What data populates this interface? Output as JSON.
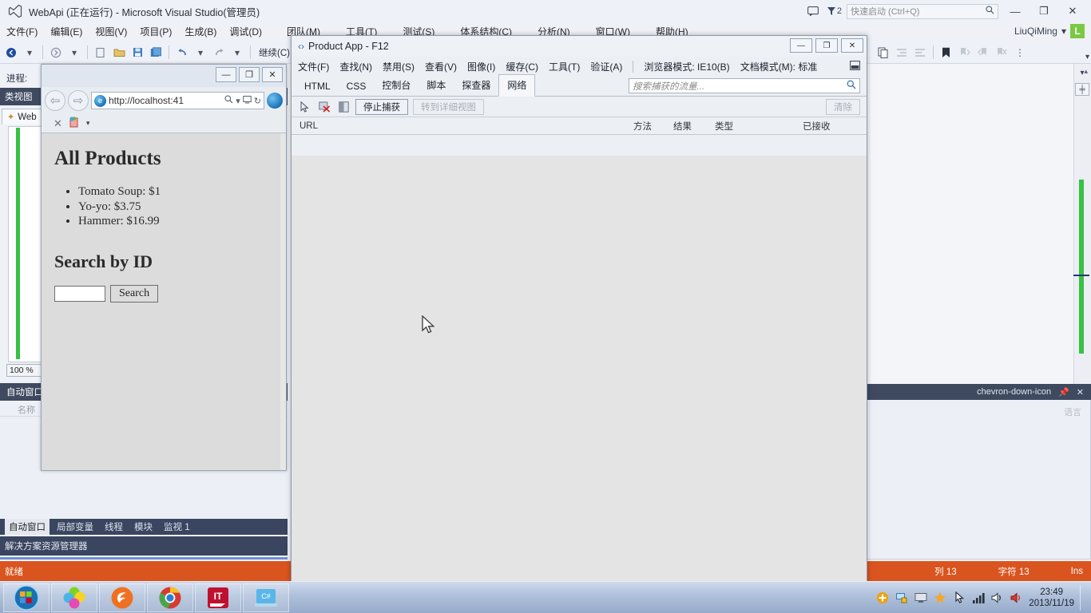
{
  "vs": {
    "title": "WebApi (正在运行) - Microsoft Visual Studio(管理员)",
    "logo_icon": "visual-studio-logo",
    "menu": [
      "文件(F)",
      "编辑(E)",
      "视图(V)",
      "项目(P)",
      "生成(B)",
      "调试(D)",
      "团队(M)",
      "工具(T)",
      "测试(S)",
      "体系结构(C)",
      "分析(N)",
      "窗口(W)",
      "帮助(H)"
    ],
    "titlebar_right": {
      "feedback_icon": "feedback-icon",
      "notification_icon": "notification-flag-icon",
      "notification_count": "2",
      "quick_launch_placeholder": "快速启动 (Ctrl+Q)",
      "quick_launch_value": "",
      "search_icon": "search-icon",
      "minimize": "—",
      "maximize": "❐",
      "close": "✕"
    },
    "user": {
      "name": "LiuQiMing",
      "chevron": "▾",
      "avatar_letter": "L",
      "avatar_color": "#7ac943"
    },
    "toolbar": {
      "continue_label": "继续(C)",
      "icons": [
        "back-icon",
        "forward-icon",
        "navigate-icon",
        "open-icon",
        "save-icon",
        "save-all-icon",
        "undo-icon",
        "redo-icon",
        "copy-icon",
        "indent-icon",
        "outdent-icon",
        "bookmark-icon",
        "comment-icon",
        "uncomment-icon",
        "overflow-icon"
      ]
    },
    "left_panel": {
      "process_label": "进程:",
      "classview_title": "类视图",
      "classview_chevron": "▾",
      "web_tab_label": "Web",
      "web_tab_icon": "web-file-icon",
      "zoom_level": "100 %",
      "auto_window_title": "自动窗口",
      "column_header": "名称"
    },
    "bottom_tabs": [
      {
        "label": "自动窗口",
        "active": true
      },
      {
        "label": "局部变量",
        "active": false
      },
      {
        "label": "线程",
        "active": false
      },
      {
        "label": "模块",
        "active": false
      },
      {
        "label": "监视 1",
        "active": false
      }
    ],
    "solution_explorer_label": "解决方案资源管理器",
    "right_dock": {
      "dropdown_icon": "chevron-down-icon",
      "pin_icon": "pin-icon",
      "close_icon": "close-icon",
      "faint_text": "语言"
    },
    "statusbar": {
      "status": "就绪",
      "column": "列 13",
      "character": "字符 13",
      "insert_mode": "Ins",
      "color": "#d9541e"
    }
  },
  "ie": {
    "window_buttons": {
      "minimize": "—",
      "maximize": "❐",
      "close": "✕"
    },
    "back_icon": "back-arrow-icon",
    "forward_icon": "forward-arrow-icon",
    "address": "http://localhost:41",
    "address_icons": {
      "search": "🔎",
      "dropdown": "▾",
      "compat": "⛶",
      "refresh": "↻"
    },
    "tab_close_icon": "✕",
    "tab_icon": "page-icon",
    "tab_dropdown": "▾",
    "page": {
      "heading1": "All Products",
      "products": [
        "Tomato Soup: $1",
        "Yo-yo: $3.75",
        "Hammer: $16.99"
      ],
      "heading2": "Search by ID",
      "search_value": "",
      "search_button": "Search"
    }
  },
  "f12": {
    "title": "Product App - F12",
    "title_icon": "f12-code-icon",
    "window_buttons": {
      "minimize": "—",
      "maximize": "❐",
      "close": "✕"
    },
    "menu": [
      "文件(F)",
      "查找(N)",
      "禁用(S)",
      "查看(V)",
      "图像(I)",
      "缓存(C)",
      "工具(T)",
      "验证(A)"
    ],
    "browser_mode": "浏览器模式: IE10(B)",
    "document_mode": "文档模式(M): 标准",
    "dock_icon": "dock-icon",
    "tabs": [
      {
        "label": "HTML",
        "active": false
      },
      {
        "label": "CSS",
        "active": false
      },
      {
        "label": "控制台",
        "active": false
      },
      {
        "label": "脚本",
        "active": false
      },
      {
        "label": "探查器",
        "active": false
      },
      {
        "label": "网络",
        "active": true
      }
    ],
    "search_placeholder": "搜索捕获的流量...",
    "search_value": "",
    "search_icon": "search-icon",
    "toolbar": {
      "select_icon": "cursor-select-icon",
      "clear_entries_icon": "clear-entries-icon",
      "image_icon": "image-icon",
      "stop_capture": "停止捕获",
      "detail_view": "转到详细视图",
      "clear": "清除"
    },
    "columns": [
      "URL",
      "方法",
      "结果",
      "类型",
      "已接收"
    ],
    "rows": []
  },
  "taskbar": {
    "items": [
      {
        "name": "start-orb",
        "label": ""
      },
      {
        "name": "flower-app",
        "label": ""
      },
      {
        "name": "firefox-browser",
        "label": ""
      },
      {
        "name": "chrome-browser",
        "label": ""
      },
      {
        "name": "it-app",
        "label": "IT"
      },
      {
        "name": "visual-studio-csharp",
        "label": "C#"
      }
    ],
    "tray_icons": [
      "update-icon",
      "network-secure-icon",
      "display-icon",
      "star-icon",
      "pointer-icon",
      "signal-icon",
      "volume-icon",
      "speaker-icon"
    ],
    "clock_time": "23:49",
    "clock_date": "2013/11/19"
  }
}
